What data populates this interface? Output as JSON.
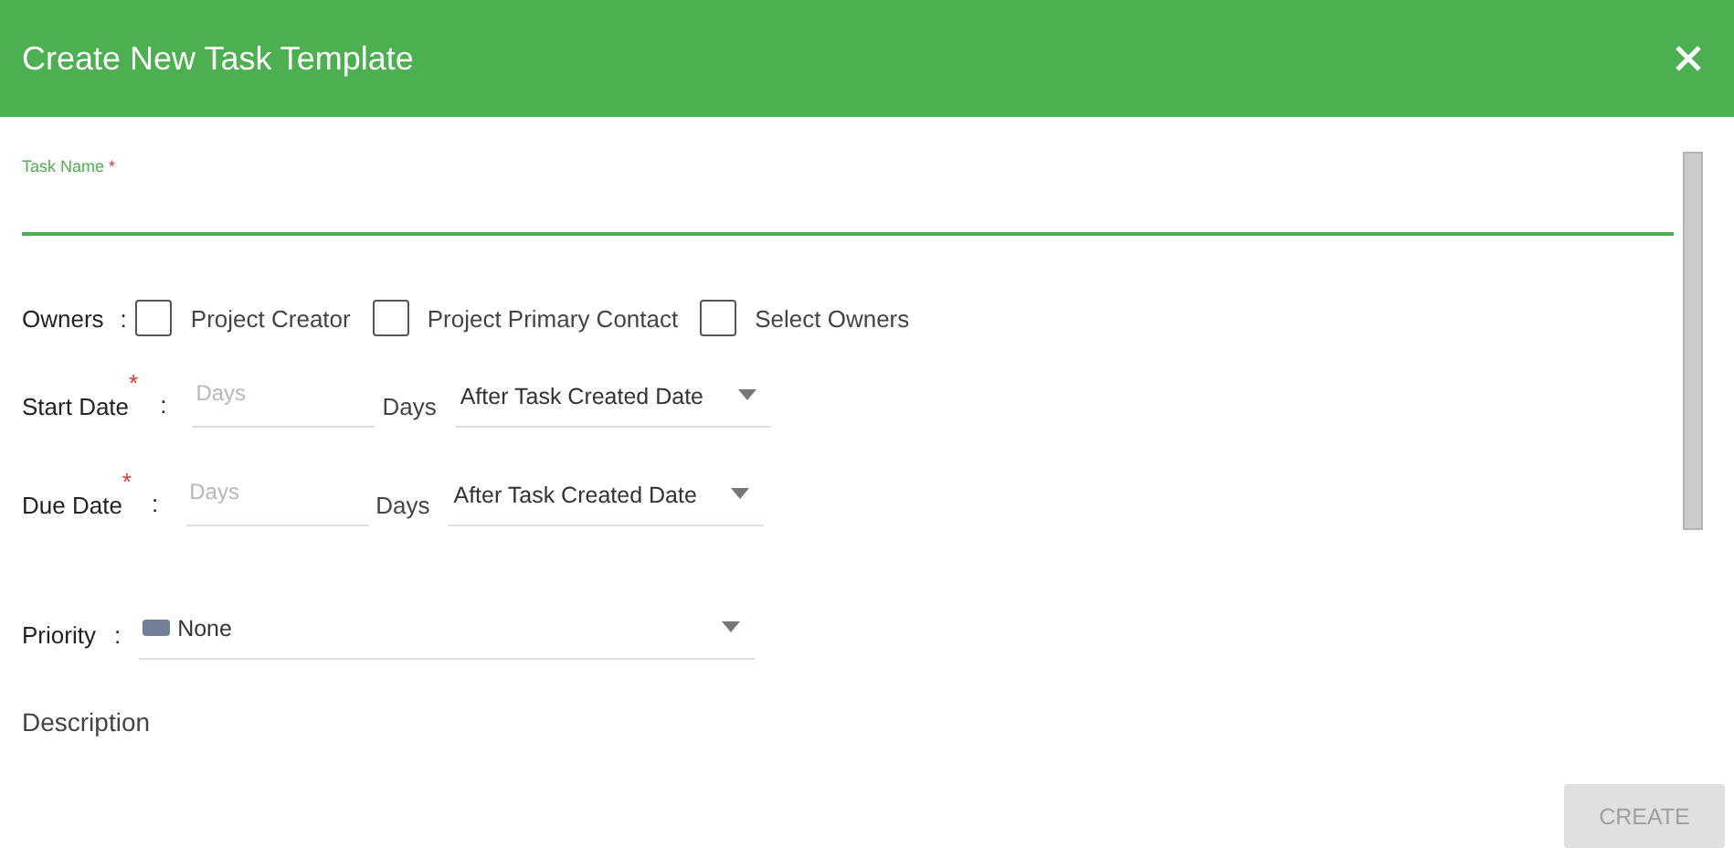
{
  "dialog": {
    "title": "Create New Task Template"
  },
  "task_name": {
    "label": "Task Name",
    "required_mark": "*"
  },
  "owners": {
    "label": "Owners",
    "separator": ":",
    "options": [
      {
        "label": "Project Creator",
        "checked": false
      },
      {
        "label": "Project Primary Contact",
        "checked": false
      },
      {
        "label": "Select Owners",
        "checked": false
      }
    ]
  },
  "dates": [
    {
      "label": "Start Date",
      "required_mark": "*",
      "separator": ":",
      "placeholder": "Days",
      "unit": "Days",
      "relative_to": "After Task Created Date"
    },
    {
      "label": "Due Date",
      "required_mark": "*",
      "separator": ":",
      "placeholder": "Days",
      "unit": "Days",
      "relative_to": "After Task Created Date"
    }
  ],
  "priority": {
    "label": "Priority",
    "separator": ":",
    "value": "None",
    "color": "#718096"
  },
  "description": {
    "label": "Description"
  },
  "create_button": {
    "label": "CREATE",
    "disabled": true
  }
}
